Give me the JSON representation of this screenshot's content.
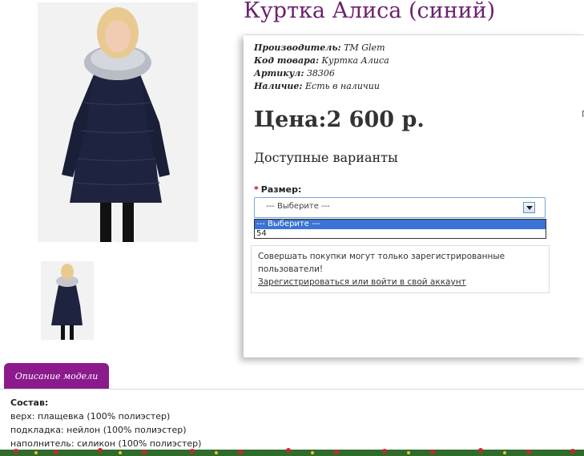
{
  "product": {
    "title": "Куртка Алиса (синий)"
  },
  "meta": [
    {
      "key": "Производитель:",
      "value": "TM Glem"
    },
    {
      "key": "Код товара:",
      "value": "Куртка Алиса"
    },
    {
      "key": "Артикул:",
      "value": "38306"
    },
    {
      "key": "Наличие:",
      "value": "Есть в наличии"
    }
  ],
  "price": "Цена:2 600 р.",
  "variants_title": "Доступные варианты",
  "size": {
    "required_mark": "*",
    "label": "Размер:",
    "selected": "--- Выберите ---",
    "options": [
      "--- Выберите ---",
      "54"
    ]
  },
  "notice": {
    "text": "Совершать покупки могут только зарегистрированные пользователи!",
    "link": "Зарегистрироваться или войти в свой аккаунт"
  },
  "right_mark": "Г",
  "tab": {
    "label": "Описание модели"
  },
  "description": {
    "heading": "Состав:",
    "lines": [
      "верх: плащевка (100% полиэстер)",
      "подкладка: нейлон (100% полиэстер)",
      "наполнитель: силикон (100% полиэстер)"
    ]
  },
  "colors": {
    "title": "#6b2170",
    "tab": "#8b1a8c",
    "select_highlight": "#3a73d3",
    "required": "#d00000"
  }
}
